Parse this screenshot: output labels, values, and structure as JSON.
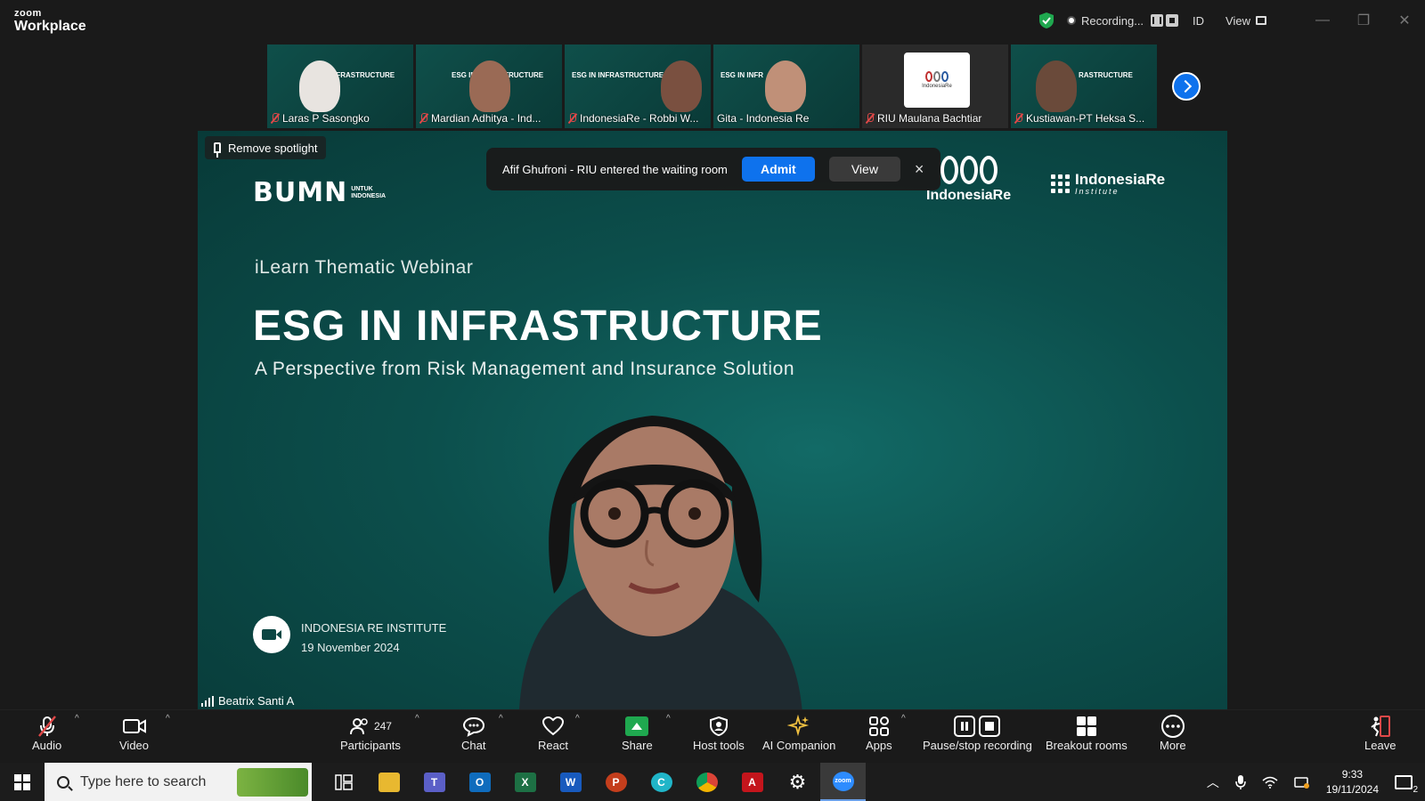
{
  "app": {
    "brand_top": "zoom",
    "brand_bottom": "Workplace"
  },
  "titlebar": {
    "recording": "Recording...",
    "lang": "ID",
    "view": "View"
  },
  "participants_strip": [
    {
      "name": "Laras P Sasongko",
      "slide": "ESG IN INFRASTRUCTURE"
    },
    {
      "name": "Mardian Adhitya - Ind...",
      "slide": "ESG IN INFRASTRUCTURE"
    },
    {
      "name": "IndonesiaRe - Robbi W...",
      "slide": "ESG IN INFRASTRUCTURE"
    },
    {
      "name": "Gita - Indonesia Re",
      "slide": "ESG IN INFR"
    },
    {
      "name": "RIU Maulana Bachtiar",
      "logo": "IndonesiaRe"
    },
    {
      "name": "Kustiawan-PT Heksa S...",
      "slide": "RASTRUCTURE"
    }
  ],
  "stage": {
    "remove_spotlight": "Remove spotlight",
    "bumn_big": "BUMN",
    "bumn_small_1": "UNTUK",
    "bumn_small_2": "INDONESIA",
    "ire_logo": "IndonesiaRe",
    "iri_logo_1": "IndonesiaRe",
    "iri_logo_2": "Institute",
    "subtitle": "iLearn Thematic Webinar",
    "title": "ESG IN INFRASTRUCTURE",
    "tagline": "A Perspective from Risk Management and Insurance Solution",
    "institute": "INDONESIA RE INSTITUTE",
    "date": "19 November 2024",
    "speaker": "Beatrix Santi A"
  },
  "waiting_room": {
    "message": "Afif Ghufroni - RIU entered the waiting room",
    "admit": "Admit",
    "view": "View",
    "close": "×"
  },
  "toolbar": {
    "audio": "Audio",
    "video": "Video",
    "participants": "Participants",
    "participants_count": "247",
    "chat": "Chat",
    "react": "React",
    "share": "Share",
    "host_tools": "Host tools",
    "ai_companion": "AI Companion",
    "apps": "Apps",
    "pause_stop": "Pause/stop recording",
    "breakout": "Breakout rooms",
    "more": "More",
    "leave": "Leave"
  },
  "taskbar": {
    "search_placeholder": "Type here to search",
    "time": "9:33",
    "date": "19/11/2024",
    "notif_count": "2"
  },
  "colors": {
    "accent": "#0e72ed",
    "share": "#1fa84f",
    "leave": "#e04848",
    "stage": "#0c4f4c"
  }
}
